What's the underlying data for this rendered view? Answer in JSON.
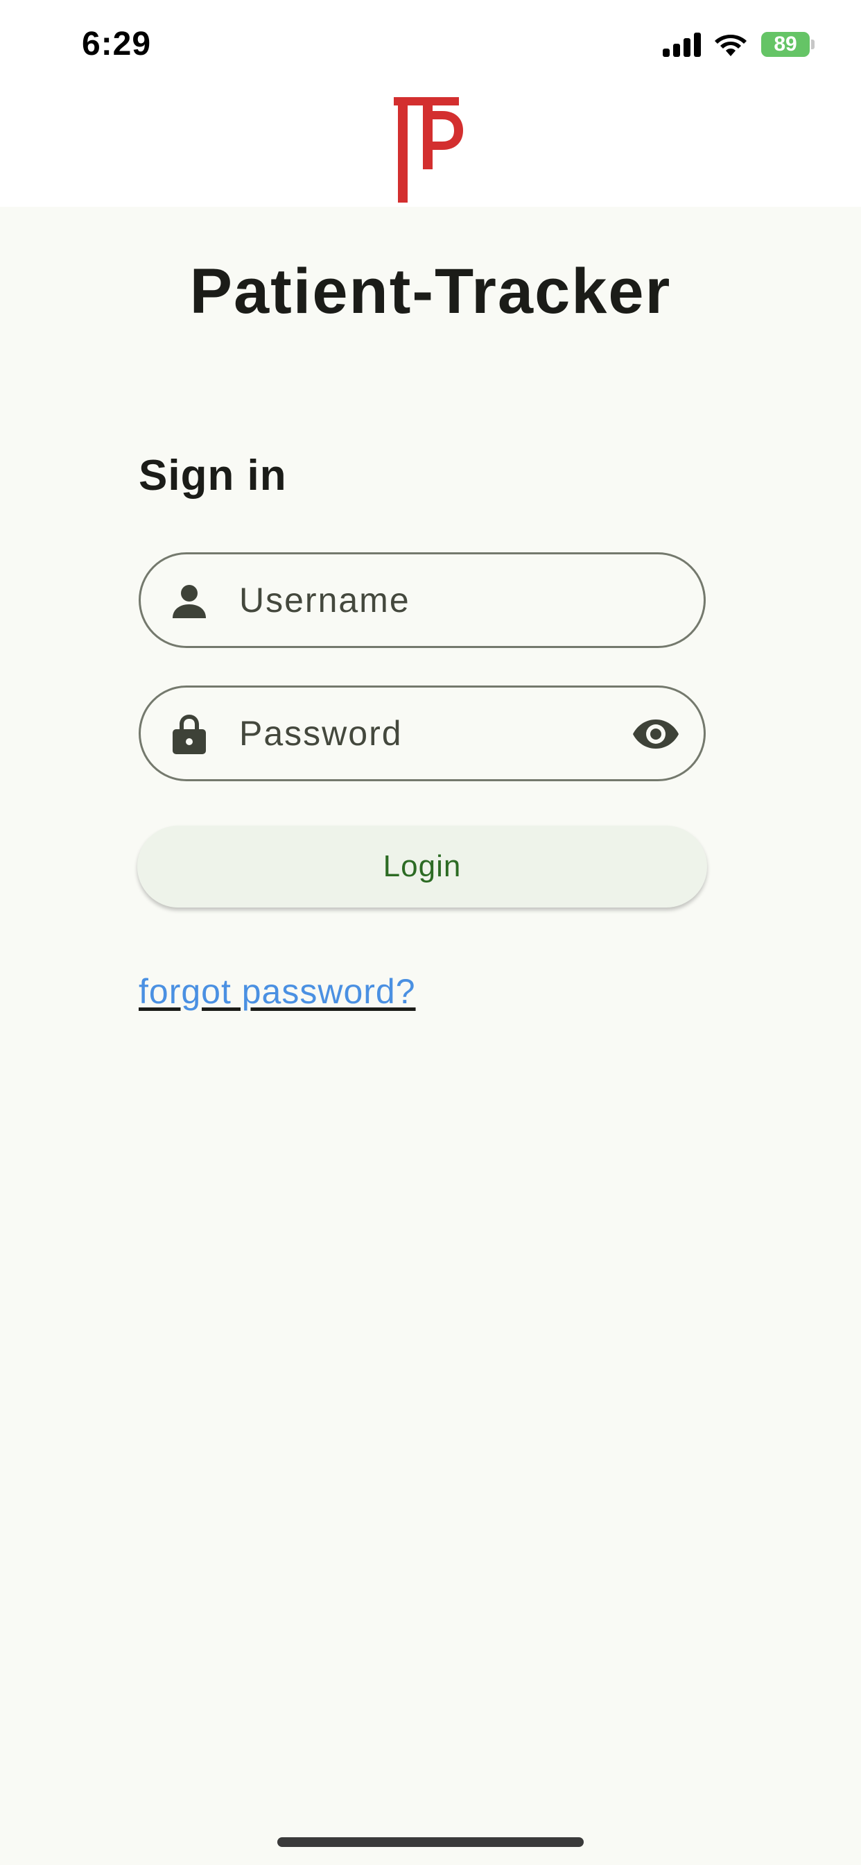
{
  "status_bar": {
    "time": "6:29",
    "battery_percent": "89",
    "icons": [
      "cellular-signal-icon",
      "wifi-icon",
      "battery-charging-icon"
    ]
  },
  "app": {
    "title": "Patient-Tracker",
    "logo_icon": "tp-monogram-logo",
    "brand_color": "#d32f2f"
  },
  "form": {
    "heading": "Sign in",
    "username": {
      "placeholder": "Username",
      "value": "",
      "icon": "person-icon"
    },
    "password": {
      "placeholder": "Password",
      "value": "",
      "icon": "lock-icon",
      "toggle_icon": "eye-icon"
    },
    "login_label": "Login",
    "forgot_label": "forgot password?"
  },
  "colors": {
    "background": "#f9faf5",
    "button_text": "#2c6b24",
    "link": "#4a90e2"
  }
}
